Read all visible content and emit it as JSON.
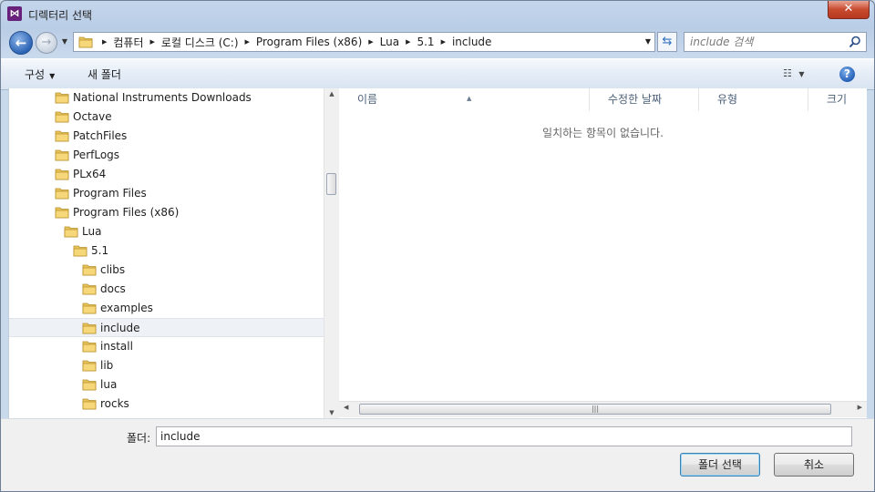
{
  "window": {
    "title": "디렉터리 선택",
    "app_icon": "visual-studio-icon"
  },
  "nav": {
    "breadcrumbs": [
      "컴퓨터",
      "로컬 디스크 (C:)",
      "Program Files (x86)",
      "Lua",
      "5.1",
      "include"
    ],
    "search_placeholder": "include 검색"
  },
  "toolbar": {
    "organize_label": "구성",
    "new_folder_label": "새 폴더"
  },
  "tree": {
    "items": [
      {
        "label": "National Instruments Downloads",
        "depth": 0
      },
      {
        "label": "Octave",
        "depth": 0
      },
      {
        "label": "PatchFiles",
        "depth": 0
      },
      {
        "label": "PerfLogs",
        "depth": 0
      },
      {
        "label": "PLx64",
        "depth": 0
      },
      {
        "label": "Program Files",
        "depth": 0
      },
      {
        "label": "Program Files (x86)",
        "depth": 0
      },
      {
        "label": "Lua",
        "depth": 1
      },
      {
        "label": "5.1",
        "depth": 2
      },
      {
        "label": "clibs",
        "depth": 3
      },
      {
        "label": "docs",
        "depth": 3
      },
      {
        "label": "examples",
        "depth": 3
      },
      {
        "label": "include",
        "depth": 3,
        "selected": true
      },
      {
        "label": "install",
        "depth": 3
      },
      {
        "label": "lib",
        "depth": 3
      },
      {
        "label": "lua",
        "depth": 3
      },
      {
        "label": "rocks",
        "depth": 3
      }
    ]
  },
  "files": {
    "columns": [
      "이름",
      "수정한 날짜",
      "유형",
      "크기"
    ],
    "empty_message": "일치하는 항목이 없습니다."
  },
  "footer": {
    "folder_label": "폴더:",
    "folder_value": "include",
    "select_button": "폴더 선택",
    "cancel_button": "취소"
  },
  "colors": {
    "folder": "#e8c35a",
    "accent": "#2b64b5",
    "close": "#c7492e"
  }
}
